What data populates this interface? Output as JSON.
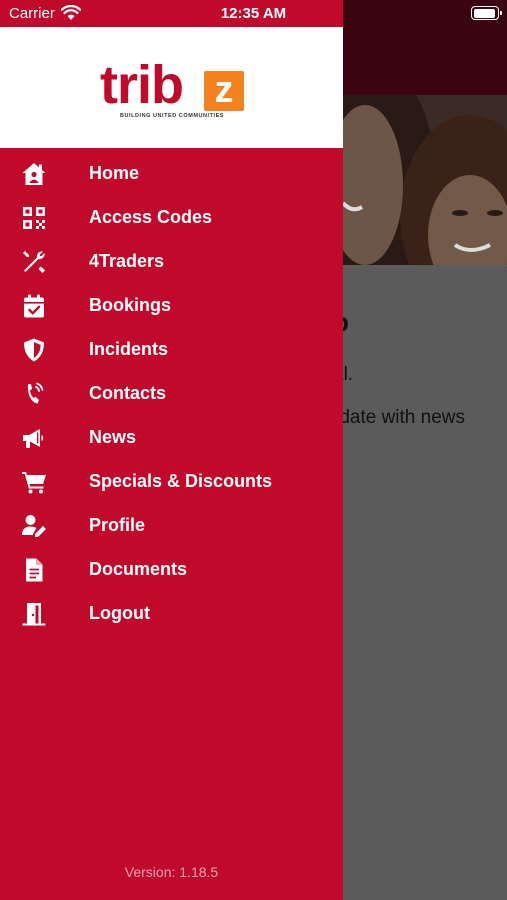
{
  "status_bar": {
    "carrier": "Carrier",
    "time": "12:35 AM"
  },
  "logo": {
    "word": "trib",
    "letter": "z",
    "tagline": "BUILDING UNITED COMMUNITIES"
  },
  "menu": {
    "items": [
      {
        "label": "Home",
        "icon": "home-icon"
      },
      {
        "label": "Access Codes",
        "icon": "qr-code-icon"
      },
      {
        "label": "4Traders",
        "icon": "tools-icon"
      },
      {
        "label": "Bookings",
        "icon": "calendar-check-icon"
      },
      {
        "label": "Incidents",
        "icon": "shield-icon"
      },
      {
        "label": "Contacts",
        "icon": "phone-icon"
      },
      {
        "label": "News",
        "icon": "megaphone-icon"
      },
      {
        "label": "Specials & Discounts",
        "icon": "cart-icon"
      },
      {
        "label": "Profile",
        "icon": "user-edit-icon"
      },
      {
        "label": "Documents",
        "icon": "document-icon"
      },
      {
        "label": "Logout",
        "icon": "door-icon"
      }
    ]
  },
  "version": "Version: 1.18.5",
  "background": {
    "heading": "p",
    "line1": "al.",
    "line2": "-date with news"
  },
  "colors": {
    "drawer": "#c0092b",
    "logo_orange": "#f4821f",
    "header_dim": "#3c0611",
    "overlay": "#5b5b5b"
  }
}
